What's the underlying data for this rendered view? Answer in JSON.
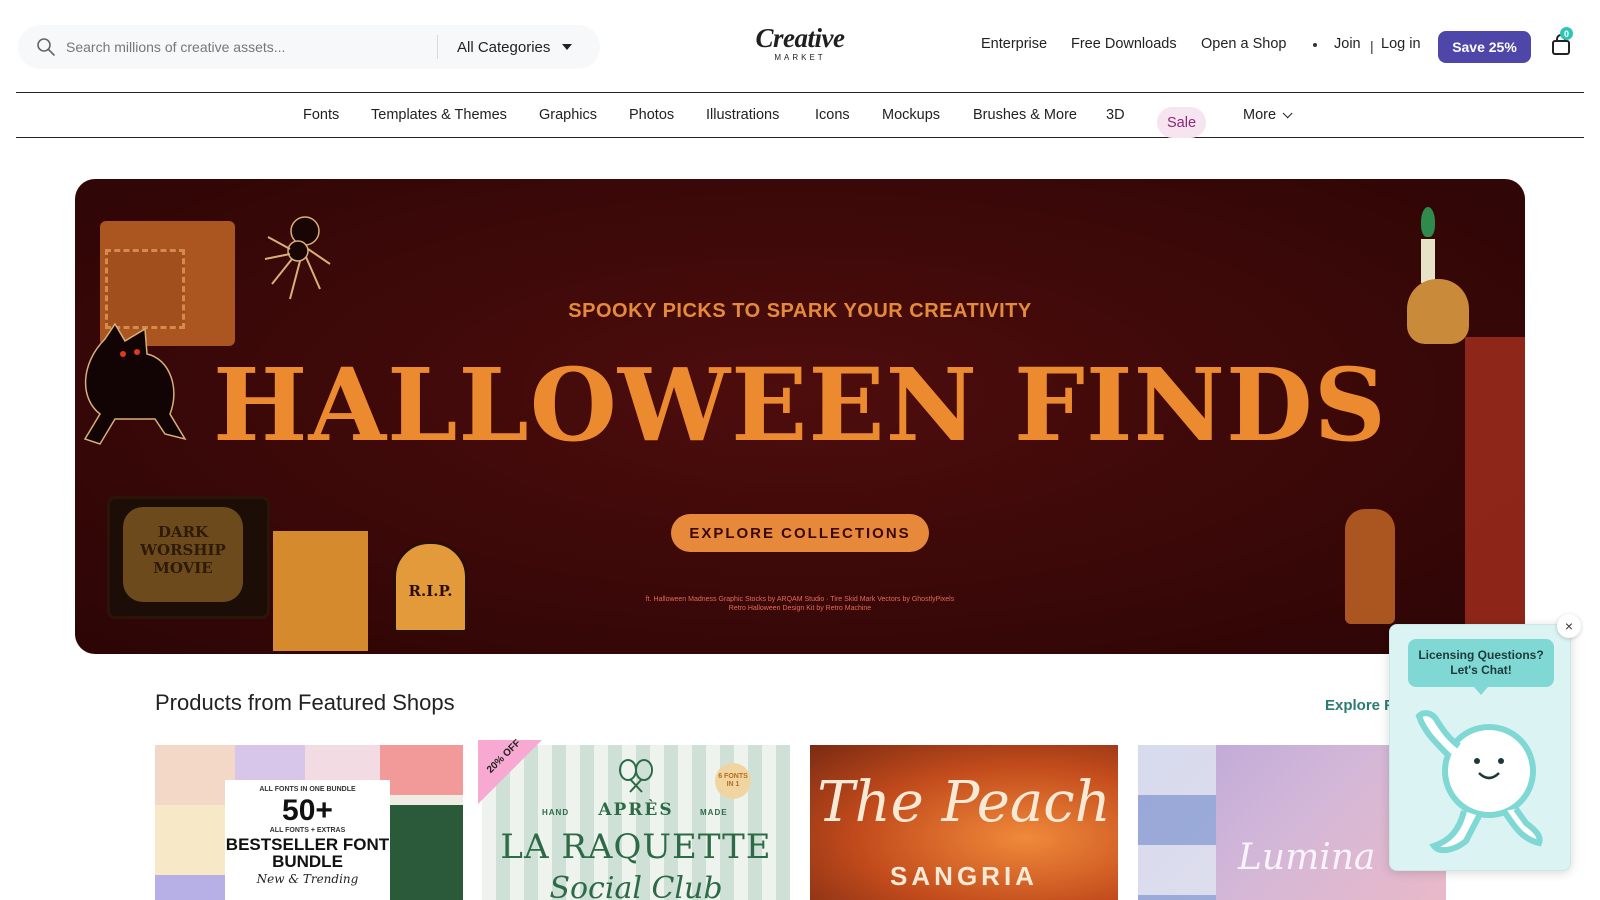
{
  "header": {
    "search": {
      "placeholder": "Search millions of creative assets..."
    },
    "category_select": "All Categories",
    "logo": {
      "main": "Creative",
      "sub": "MARKET"
    },
    "nav": {
      "enterprise": "Enterprise",
      "free_downloads": "Free Downloads",
      "open_shop": "Open a Shop",
      "join": "Join",
      "separator": "|",
      "login": "Log in"
    },
    "save_button": "Save 25%",
    "cart_count": "0"
  },
  "category_nav": {
    "items": [
      "Fonts",
      "Templates & Themes",
      "Graphics",
      "Photos",
      "Illustrations",
      "Icons",
      "Mockups",
      "Brushes & More",
      "3D",
      "Sale",
      "More"
    ]
  },
  "hero": {
    "eyebrow": "SPOOKY PICKS TO SPARK YOUR CREATIVITY",
    "title": "HALLOWEEN FINDS",
    "cta": "EXPLORE COLLECTIONS",
    "credit_line1": "ft. Halloween Madness Graphic Stocks by ARQAM Studio · Tire Skid Mark Vectors by GhostlyPixels",
    "credit_line2": "Retro Halloween Design Kit by Retro Machine",
    "tv_text": "DARK WORSHIP MOVIE",
    "tomb_text": "R.I.P."
  },
  "featured": {
    "title": "Products from Featured Shops",
    "explore_link": "Explore F",
    "cards": [
      {
        "top": "ALL FONTS IN ONE BUNDLE",
        "big": "50+",
        "extras": "ALL FONTS + EXTRAS",
        "title": "BESTSELLER FONT BUNDLE",
        "sub": "New & Trending"
      },
      {
        "discount": "20% OFF",
        "apres": "APRÈS",
        "left": "HAND",
        "right": "MADE",
        "badge": "6 FONTS IN 1",
        "title": "LA RAQUETTE",
        "sub": "Social Club"
      },
      {
        "title": "The Peach",
        "sub": "SANGRIA"
      },
      {
        "title": "Lumina"
      }
    ]
  },
  "chat": {
    "bubble": "Licensing Questions? Let's Chat!",
    "close": "×"
  },
  "colors": {
    "brand_purple": "#4e46a8",
    "hero_bg": "#3b0808",
    "hero_orange": "#eb8a2f",
    "teal_link": "#2b7b74",
    "sale_pink": "#f6e4f1"
  }
}
